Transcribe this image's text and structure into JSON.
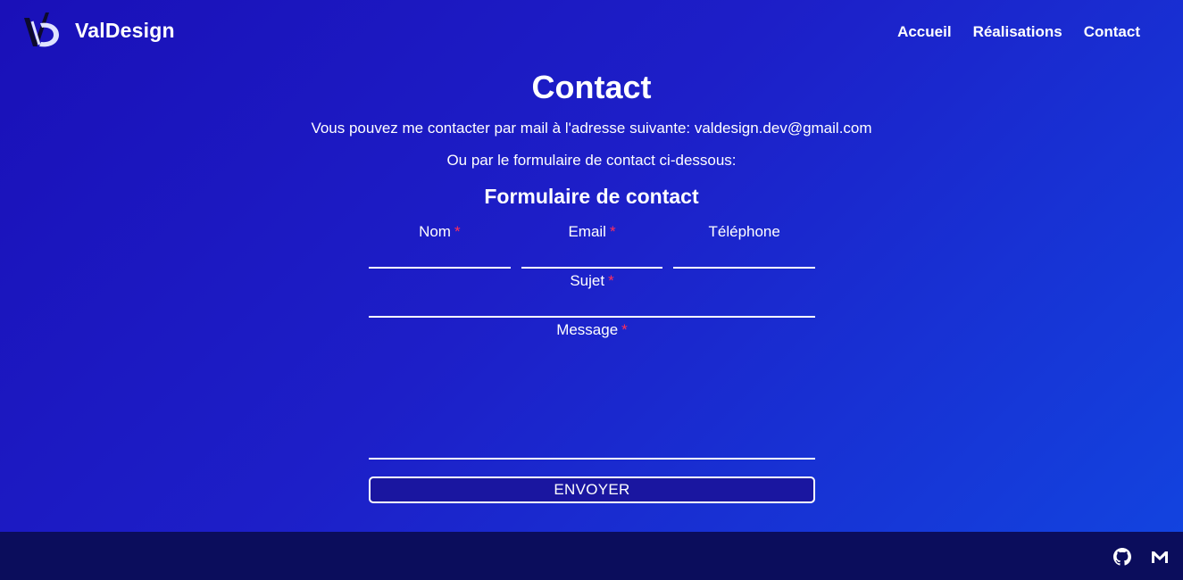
{
  "header": {
    "brand_name": "ValDesign",
    "logo_icon": "valdesign-logo",
    "nav": [
      {
        "label": "Accueil"
      },
      {
        "label": "Réalisations"
      },
      {
        "label": "Contact"
      }
    ]
  },
  "main": {
    "title": "Contact",
    "intro": "Vous pouvez me contacter par mail à l'adresse suivante: valdesign.dev@gmail.com",
    "intro2": "Ou par le formulaire de contact ci-dessous:",
    "form_title": "Formulaire de contact"
  },
  "form": {
    "required_marker": "*",
    "nom": {
      "label": "Nom",
      "value": ""
    },
    "email": {
      "label": "Email",
      "value": ""
    },
    "telephone": {
      "label": "Téléphone",
      "value": ""
    },
    "sujet": {
      "label": "Sujet",
      "value": ""
    },
    "message": {
      "label": "Message",
      "value": ""
    },
    "submit_label": "ENVOYER"
  },
  "footer": {
    "icons": [
      "github-icon",
      "gmail-icon"
    ]
  },
  "colors": {
    "background_start": "#1a10b8",
    "background_end": "#1245e0",
    "footer": "#0b0d5c",
    "required": "#ff2f5a",
    "text": "#ffffff"
  }
}
